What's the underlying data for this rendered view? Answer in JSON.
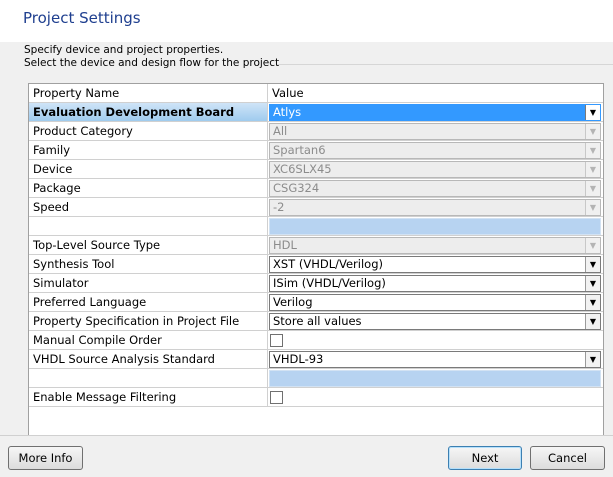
{
  "header": {
    "title": "Project Settings"
  },
  "description": {
    "line1": "Specify device and project properties.",
    "line2": "Select the device and design flow for the project"
  },
  "table": {
    "columns": [
      "Property Name",
      "Value"
    ],
    "rows": [
      {
        "name": "Evaluation Development Board",
        "value": "Atlys"
      },
      {
        "name": "Product Category",
        "value": "All"
      },
      {
        "name": "Family",
        "value": "Spartan6"
      },
      {
        "name": "Device",
        "value": "XC6SLX45"
      },
      {
        "name": "Package",
        "value": "CSG324"
      },
      {
        "name": "Speed",
        "value": "-2"
      },
      {
        "name": "",
        "value": ""
      },
      {
        "name": "Top-Level Source Type",
        "value": "HDL"
      },
      {
        "name": "Synthesis Tool",
        "value": "XST (VHDL/Verilog)"
      },
      {
        "name": "Simulator",
        "value": "ISim (VHDL/Verilog)"
      },
      {
        "name": "Preferred Language",
        "value": "Verilog"
      },
      {
        "name": "Property Specification in Project File",
        "value": "Store all values"
      },
      {
        "name": "Manual Compile Order",
        "checked": false
      },
      {
        "name": "VHDL Source Analysis Standard",
        "value": "VHDL-93"
      },
      {
        "name": "",
        "value": ""
      },
      {
        "name": "Enable Message Filtering",
        "checked": false
      }
    ]
  },
  "buttons": {
    "more_info": "More Info",
    "next": "Next",
    "cancel": "Cancel"
  },
  "colors": {
    "title": "#1f3f8f",
    "selection": "#3399ff",
    "blank_cell": "#b7d3f1"
  }
}
